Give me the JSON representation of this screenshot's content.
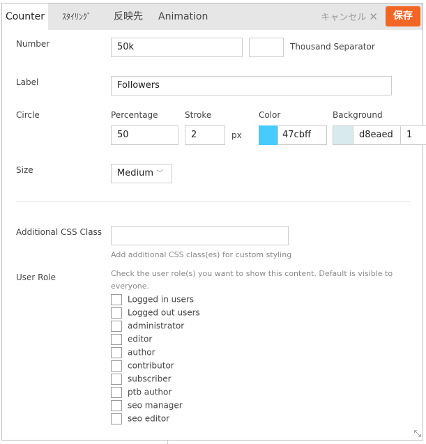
{
  "tabs": [
    {
      "label": "Counter",
      "active": true
    },
    {
      "label": "ｽﾀｲﾘﾝｸﾞ"
    },
    {
      "label": "反映先"
    },
    {
      "label": "Animation"
    }
  ],
  "header": {
    "cancel_label": "キャンセル",
    "save_label": "保存",
    "save_color": "#f26522"
  },
  "number": {
    "label": "Number",
    "value": "50k",
    "separator_value": "",
    "separator_label": "Thousand Separator"
  },
  "label_field": {
    "label": "Label",
    "value": "Followers"
  },
  "circle": {
    "label": "Circle",
    "percentage_label": "Percentage",
    "percentage": "50",
    "stroke_label": "Stroke",
    "stroke": "2",
    "stroke_unit": "px",
    "color_label": "Color",
    "color": "47cbff",
    "color_hex": "#47cbff",
    "background_label": "Background",
    "background": "d8eaed",
    "background_hex": "#d8eaed",
    "opacity": "1"
  },
  "size": {
    "label": "Size",
    "value": "Medium"
  },
  "css_class": {
    "label": "Additional CSS Class",
    "value": "",
    "help": "Add additional CSS class(es) for custom styling"
  },
  "user_role": {
    "label": "User Role",
    "help": "Check the user role(s) you want to show this content. Default is visible to everyone.",
    "options": [
      "Logged in users",
      "Logged out users",
      "administrator",
      "editor",
      "author",
      "contributor",
      "subscriber",
      "ptb author",
      "seo manager",
      "seo editor"
    ]
  }
}
